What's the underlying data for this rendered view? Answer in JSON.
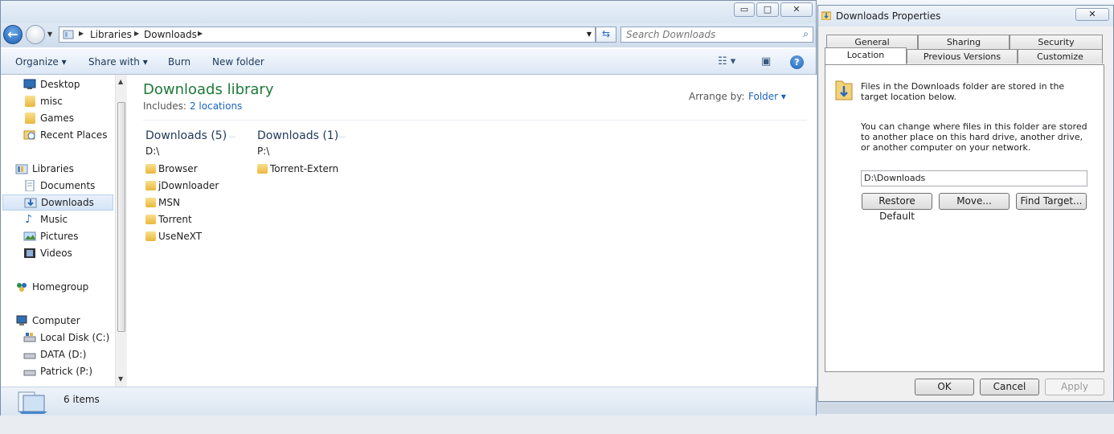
{
  "explorer": {
    "window_buttons": {
      "minimize": "▭",
      "maximize": "□",
      "close": "✕"
    },
    "breadcrumb": [
      "Libraries",
      "Downloads"
    ],
    "search_placeholder": "Search Downloads",
    "toolbar": {
      "organize": "Organize",
      "share_with": "Share with",
      "burn": "Burn",
      "new_folder": "New folder"
    },
    "nav": [
      {
        "label": "Desktop",
        "icon": "desktop-icon"
      },
      {
        "label": "misc",
        "icon": "folder-icon"
      },
      {
        "label": "Games",
        "icon": "folder-icon"
      },
      {
        "label": "Recent Places",
        "icon": "recent-places-icon"
      },
      {
        "label": "Libraries",
        "icon": "libraries-icon"
      },
      {
        "label": "Documents",
        "icon": "documents-icon"
      },
      {
        "label": "Downloads",
        "icon": "downloads-icon",
        "selected": true
      },
      {
        "label": "Music",
        "icon": "music-icon"
      },
      {
        "label": "Pictures",
        "icon": "pictures-icon"
      },
      {
        "label": "Videos",
        "icon": "videos-icon"
      },
      {
        "label": "Homegroup",
        "icon": "homegroup-icon"
      },
      {
        "label": "Computer",
        "icon": "computer-icon"
      },
      {
        "label": "Local Disk (C:)",
        "icon": "drive-icon"
      },
      {
        "label": "DATA (D:)",
        "icon": "drive-icon"
      },
      {
        "label": "Patrick (P:)",
        "icon": "drive-icon"
      }
    ],
    "library": {
      "title": "Downloads library",
      "includes_label": "Includes:",
      "includes_link": "2 locations",
      "arrange_label": "Arrange by:",
      "arrange_value": "Folder"
    },
    "groups": [
      {
        "header": "Downloads (5)",
        "path": "D:\\",
        "items": [
          "Browser",
          "jDownloader",
          "MSN",
          "Torrent",
          "UseNeXT"
        ]
      },
      {
        "header": "Downloads (1)",
        "path": "P:\\",
        "items": [
          "Torrent-Extern"
        ]
      }
    ],
    "status": {
      "count": "6 items"
    }
  },
  "properties": {
    "title": "Downloads Properties",
    "close": "✕",
    "tabs_row1": [
      "General",
      "Sharing",
      "Security"
    ],
    "tabs_row2": [
      "Location",
      "Previous Versions",
      "Customize"
    ],
    "active_tab": "Location",
    "text1": "Files in the Downloads folder are stored in the target location below.",
    "text2": "You can change where files in this folder are stored to another place on this hard drive, another drive, or another computer on your network.",
    "path_value": "D:\\Downloads",
    "buttons": {
      "restore": "Restore Default",
      "move": "Move...",
      "find": "Find Target...",
      "ok": "OK",
      "cancel": "Cancel",
      "apply": "Apply"
    }
  },
  "colors": {
    "accent": "#1a63c1",
    "library_title": "#1e7a3a",
    "selection": "#d4e4f6"
  }
}
